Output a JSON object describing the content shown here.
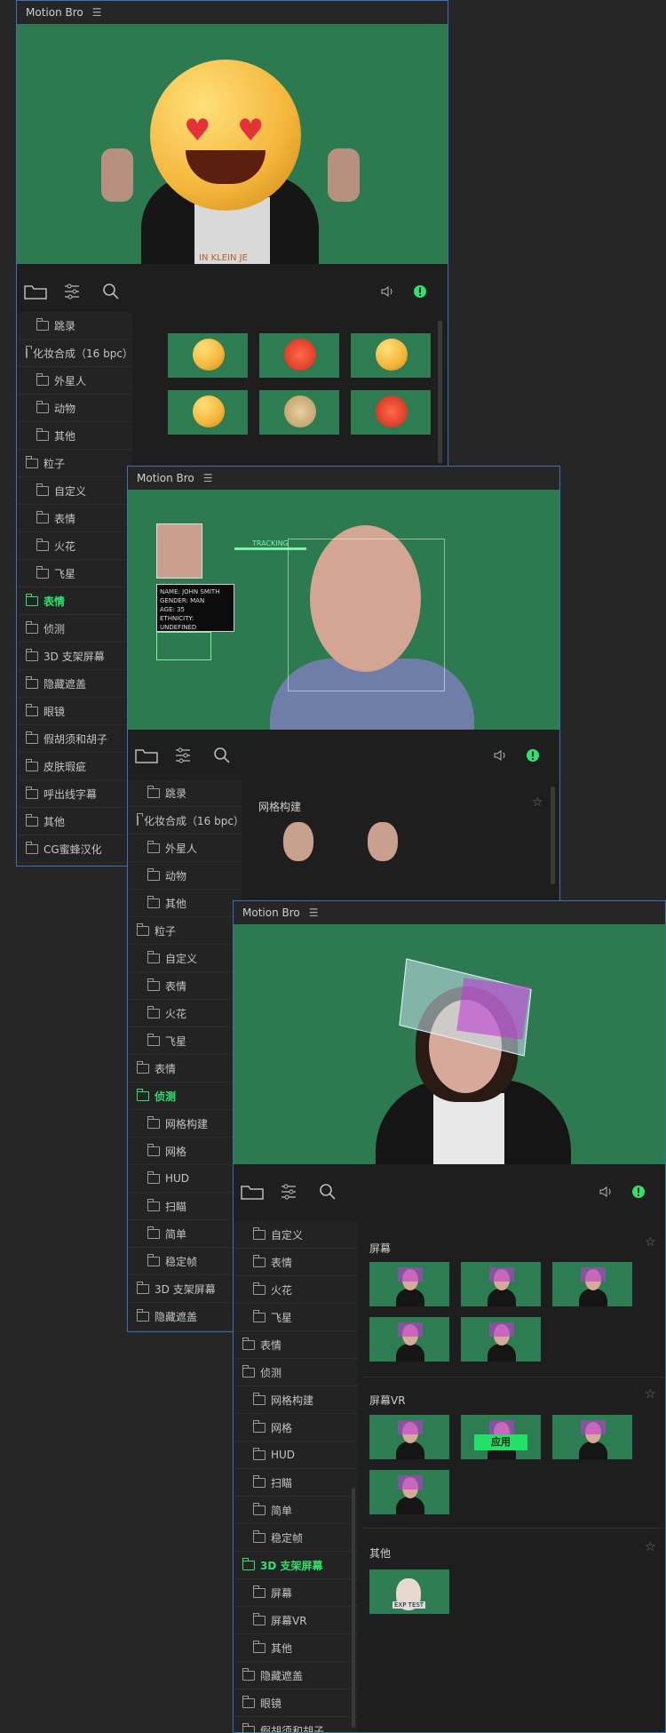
{
  "app_title": "Motion Bro",
  "panel1": {
    "title": "Motion Bro",
    "preview_shirt_text": "IN KLEIN JE",
    "sidebar": [
      {
        "label": "跳录",
        "type": "sub"
      },
      {
        "label": "化妆合成（16 bpc）",
        "type": "top"
      },
      {
        "label": "外星人",
        "type": "sub"
      },
      {
        "label": "动物",
        "type": "sub"
      },
      {
        "label": "其他",
        "type": "sub"
      },
      {
        "label": "粒子",
        "type": "top"
      },
      {
        "label": "自定义",
        "type": "sub"
      },
      {
        "label": "表情",
        "type": "sub"
      },
      {
        "label": "火花",
        "type": "sub"
      },
      {
        "label": "飞星",
        "type": "sub"
      },
      {
        "label": "表情",
        "type": "top",
        "active": true
      },
      {
        "label": "侦测",
        "type": "top"
      },
      {
        "label": "3D 支架屏幕",
        "type": "top"
      },
      {
        "label": "隐藏遮盖",
        "type": "top"
      },
      {
        "label": "眼镜",
        "type": "top"
      },
      {
        "label": "假胡须和胡子",
        "type": "top"
      },
      {
        "label": "皮肤瑕疵",
        "type": "top"
      },
      {
        "label": "呼出线字幕",
        "type": "top"
      },
      {
        "label": "其他",
        "type": "top"
      },
      {
        "label": "CG蜜蜂汉化",
        "type": "top"
      }
    ]
  },
  "panel2": {
    "title": "Motion Bro",
    "hud": {
      "name": "NAME: JOHN SMITH",
      "gender": "GENDER: MAN",
      "age": "AGE: 35",
      "ethnicity": "ETHNICITY: UNDEFINED",
      "tracking": "TRACKING"
    },
    "section_title": "网格构建",
    "sidebar": [
      {
        "label": "跳录",
        "type": "sub"
      },
      {
        "label": "化妆合成（16 bpc）",
        "type": "top"
      },
      {
        "label": "外星人",
        "type": "sub"
      },
      {
        "label": "动物",
        "type": "sub"
      },
      {
        "label": "其他",
        "type": "sub"
      },
      {
        "label": "粒子",
        "type": "top"
      },
      {
        "label": "自定义",
        "type": "sub"
      },
      {
        "label": "表情",
        "type": "sub"
      },
      {
        "label": "火花",
        "type": "sub"
      },
      {
        "label": "飞星",
        "type": "sub"
      },
      {
        "label": "表情",
        "type": "top"
      },
      {
        "label": "侦测",
        "type": "top",
        "active": true
      },
      {
        "label": "网格构建",
        "type": "sub"
      },
      {
        "label": "网格",
        "type": "sub"
      },
      {
        "label": "HUD",
        "type": "sub"
      },
      {
        "label": "扫瞄",
        "type": "sub"
      },
      {
        "label": "简单",
        "type": "sub"
      },
      {
        "label": "稳定帧",
        "type": "sub"
      },
      {
        "label": "3D 支架屏幕",
        "type": "top"
      },
      {
        "label": "隐藏遮盖",
        "type": "top"
      }
    ]
  },
  "panel3": {
    "title": "Motion Bro",
    "sections": [
      {
        "title": "屏幕",
        "count": 5
      },
      {
        "title": "屏幕VR",
        "count": 4,
        "apply_label": "应用"
      },
      {
        "title": "其他",
        "count": 1,
        "thumb_text": "EXP TEST"
      }
    ],
    "sidebar": [
      {
        "label": "自定义",
        "type": "sub"
      },
      {
        "label": "表情",
        "type": "sub"
      },
      {
        "label": "火花",
        "type": "sub"
      },
      {
        "label": "飞星",
        "type": "sub"
      },
      {
        "label": "表情",
        "type": "top"
      },
      {
        "label": "侦测",
        "type": "top"
      },
      {
        "label": "网格构建",
        "type": "sub"
      },
      {
        "label": "网格",
        "type": "sub"
      },
      {
        "label": "HUD",
        "type": "sub"
      },
      {
        "label": "扫瞄",
        "type": "sub"
      },
      {
        "label": "简单",
        "type": "sub"
      },
      {
        "label": "稳定帧",
        "type": "sub"
      },
      {
        "label": "3D 支架屏幕",
        "type": "top",
        "active": true
      },
      {
        "label": "屏幕",
        "type": "sub"
      },
      {
        "label": "屏幕VR",
        "type": "sub"
      },
      {
        "label": "其他",
        "type": "sub"
      },
      {
        "label": "隐藏遮盖",
        "type": "top"
      },
      {
        "label": "眼镜",
        "type": "top"
      },
      {
        "label": "假胡须和胡子",
        "type": "top"
      }
    ]
  },
  "colors": {
    "accent": "#2fe26e",
    "panel_border": "#3b6fb7",
    "greenscreen": "#2d7a50"
  }
}
